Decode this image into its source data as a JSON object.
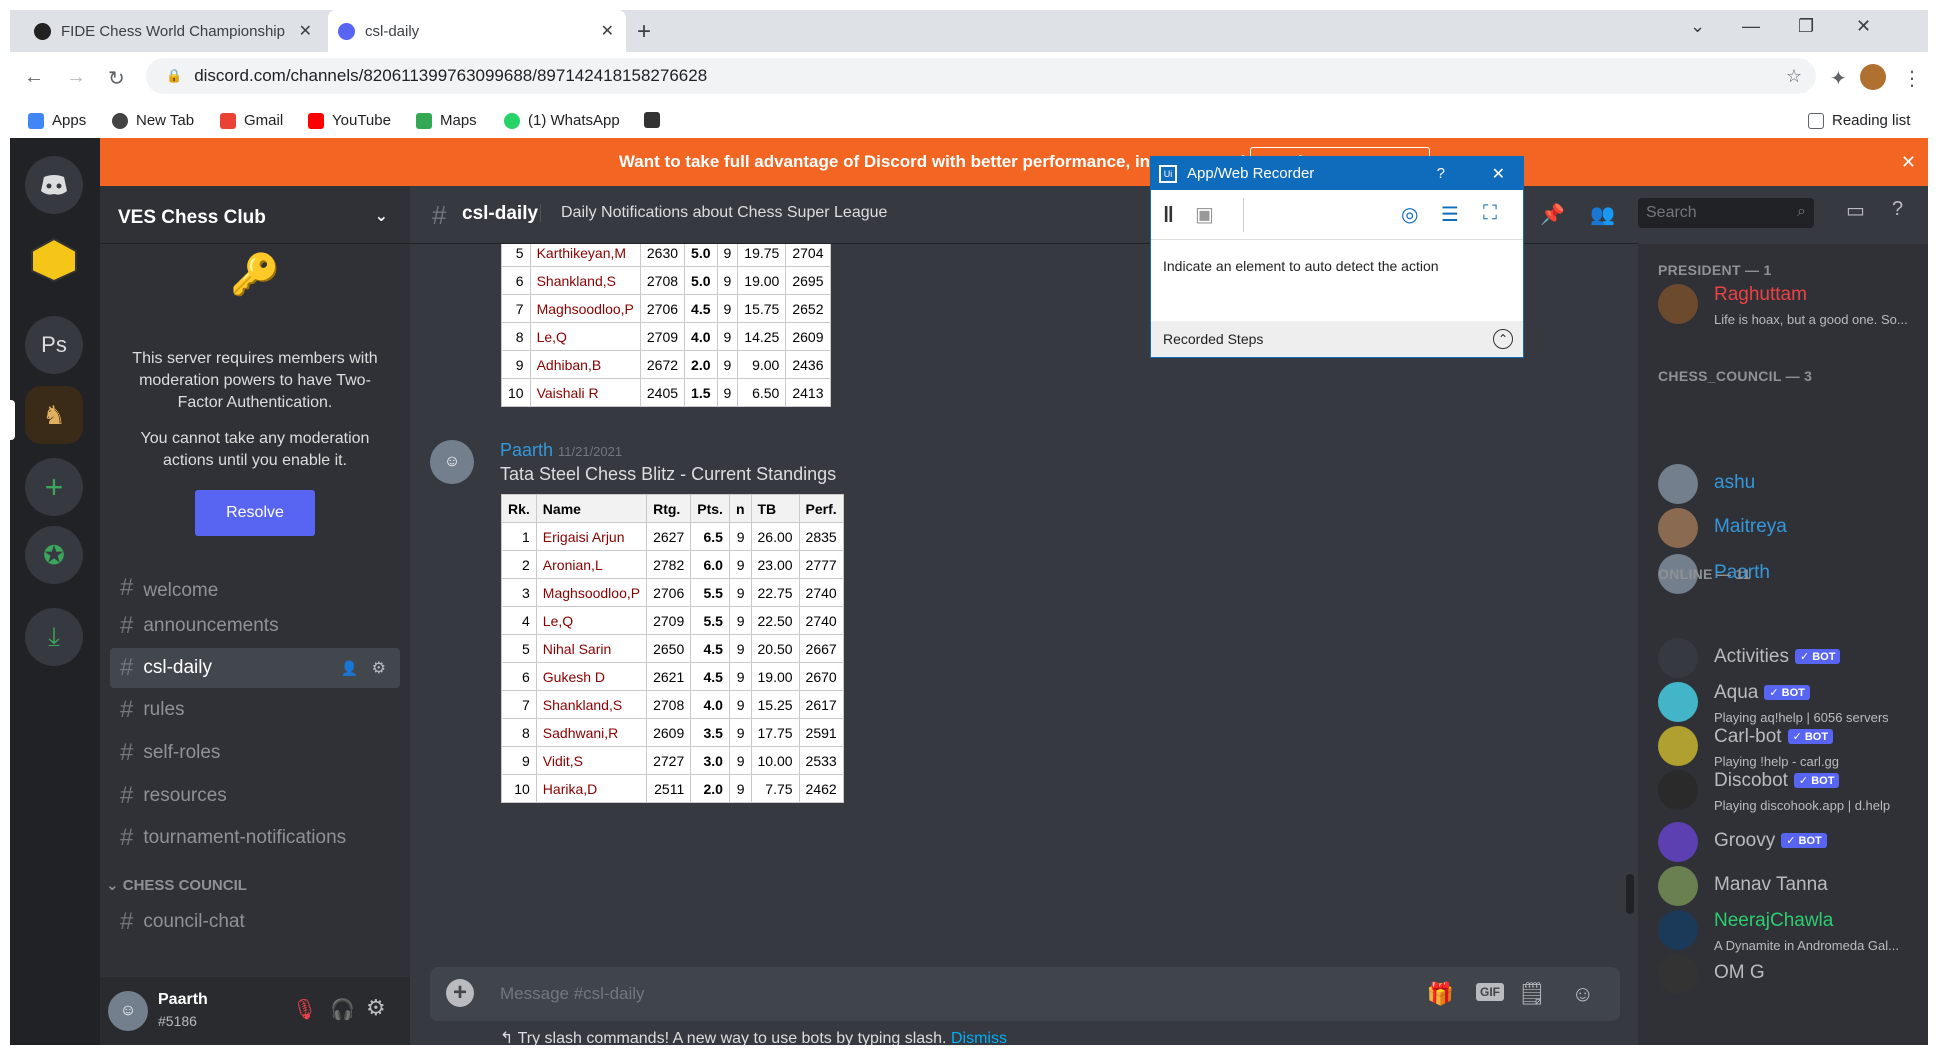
{
  "browser": {
    "tabs": [
      {
        "title": "FIDE Chess World Championship"
      },
      {
        "title": "csl-daily"
      }
    ],
    "url": "discord.com/channels/820611399763099688/897142418158276628",
    "bookmarks": [
      "Apps",
      "New Tab",
      "Gmail",
      "YouTube",
      "Maps",
      "(1) WhatsApp"
    ],
    "reading_list": "Reading list"
  },
  "banner": {
    "text": "Want to take full advantage of Discord with better performance, in-game overlay, and more"
  },
  "server": {
    "name": "VES Chess Club",
    "twofa_text1": "This server requires members with moderation powers to have Two-Factor Authentication.",
    "twofa_text2": "You cannot take any moderation actions until you enable it.",
    "resolve_label": "Resolve",
    "channels": [
      "welcome",
      "announcements",
      "csl-daily",
      "rules",
      "self-roles",
      "resources",
      "tournament-notifications"
    ],
    "category": "CHESS COUNCIL",
    "council_channels": [
      "council-chat"
    ],
    "gicon_ps": "Ps"
  },
  "user": {
    "name": "Paarth",
    "tag": "#5186"
  },
  "channel": {
    "name": "csl-daily",
    "topic": "Daily Notifications about Chess Super League",
    "search_placeholder": "Search"
  },
  "table1": {
    "rows": [
      [
        "5",
        "Karthikeyan,M",
        "2630",
        "5.0",
        "9",
        "19.75",
        "2704"
      ],
      [
        "6",
        "Shankland,S",
        "2708",
        "5.0",
        "9",
        "19.00",
        "2695"
      ],
      [
        "7",
        "Maghsoodloo,P",
        "2706",
        "4.5",
        "9",
        "15.75",
        "2652"
      ],
      [
        "8",
        "Le,Q",
        "2709",
        "4.0",
        "9",
        "14.25",
        "2609"
      ],
      [
        "9",
        "Adhiban,B",
        "2672",
        "2.0",
        "9",
        "9.00",
        "2436"
      ],
      [
        "10",
        "Vaishali R",
        "2405",
        "1.5",
        "9",
        "6.50",
        "2413"
      ]
    ]
  },
  "message": {
    "author": "Paarth",
    "timestamp": "11/21/2021",
    "text": "Tata Steel Chess Blitz - Current Standings"
  },
  "table2": {
    "headers": [
      "Rk.",
      "Name",
      "Rtg.",
      "Pts.",
      "n",
      "TB",
      "Perf."
    ],
    "rows": [
      [
        "1",
        "Erigaisi Arjun",
        "2627",
        "6.5",
        "9",
        "26.00",
        "2835"
      ],
      [
        "2",
        "Aronian,L",
        "2782",
        "6.0",
        "9",
        "23.00",
        "2777"
      ],
      [
        "3",
        "Maghsoodloo,P",
        "2706",
        "5.5",
        "9",
        "22.75",
        "2740"
      ],
      [
        "4",
        "Le,Q",
        "2709",
        "5.5",
        "9",
        "22.50",
        "2740"
      ],
      [
        "5",
        "Nihal Sarin",
        "2650",
        "4.5",
        "9",
        "20.50",
        "2667"
      ],
      [
        "6",
        "Gukesh D",
        "2621",
        "4.5",
        "9",
        "19.00",
        "2670"
      ],
      [
        "7",
        "Shankland,S",
        "2708",
        "4.0",
        "9",
        "15.25",
        "2617"
      ],
      [
        "8",
        "Sadhwani,R",
        "2609",
        "3.5",
        "9",
        "17.75",
        "2591"
      ],
      [
        "9",
        "Vidit,S",
        "2727",
        "3.0",
        "9",
        "10.00",
        "2533"
      ],
      [
        "10",
        "Harika,D",
        "2511",
        "2.0",
        "9",
        "7.75",
        "2462"
      ]
    ]
  },
  "composer": {
    "placeholder": "Message #csl-daily",
    "slash_hint": "Try slash commands! A new way to use bots by typing slash.",
    "dismiss": "Dismiss",
    "gif_label": "GIF"
  },
  "members": {
    "president_header": "PRESIDENT — 1",
    "council_header": "CHESS_COUNCIL — 3",
    "online_header": "ONLINE — 11",
    "bot_label": "✓ BOT",
    "list": [
      {
        "name": "Raghuttam",
        "sub": "Life is hoax, but a good one. So...",
        "color": "#ed4245"
      },
      {
        "name": "ashu",
        "sub": "",
        "color": "#3498db"
      },
      {
        "name": "Maitreya",
        "sub": "",
        "color": "#3498db"
      },
      {
        "name": "Paarth",
        "sub": "",
        "color": "#3498db"
      },
      {
        "name": "Activities",
        "sub": "",
        "color": "#b9bbbe"
      },
      {
        "name": "Aqua",
        "sub": "Playing aq!help | 6056 servers",
        "color": "#b9bbbe"
      },
      {
        "name": "Carl-bot",
        "sub": "Playing !help - carl.gg",
        "color": "#b9bbbe"
      },
      {
        "name": "Discobot",
        "sub": "Playing discohook.app | d.help",
        "color": "#b9bbbe"
      },
      {
        "name": "Groovy",
        "sub": "",
        "color": "#b9bbbe"
      },
      {
        "name": "Manav Tanna",
        "sub": "",
        "color": "#b9bbbe"
      },
      {
        "name": "NeerajChawla",
        "sub": "A Dynamite in Andromeda Gal...",
        "color": "#2ecc71"
      },
      {
        "name": "OM G",
        "sub": "",
        "color": "#b9bbbe"
      }
    ]
  },
  "recorder": {
    "title": "App/Web Recorder",
    "help": "?",
    "message": "Indicate an element to auto detect the action",
    "steps_label": "Recorded Steps"
  }
}
